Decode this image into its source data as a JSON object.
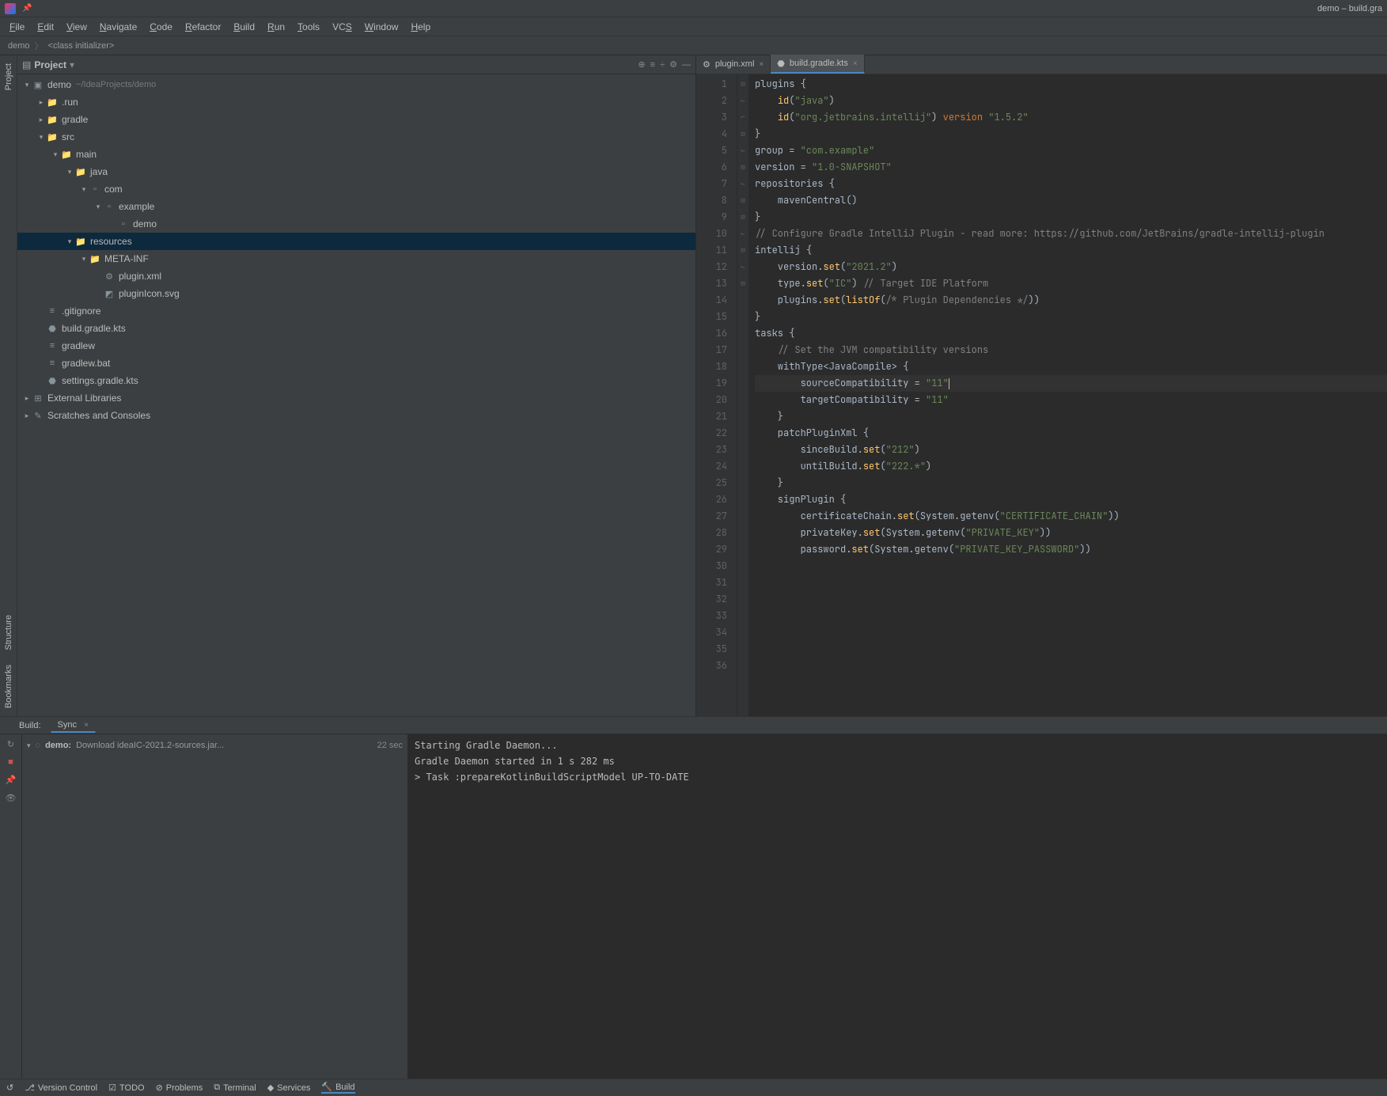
{
  "title_right": "demo – build.gra",
  "menu": [
    "File",
    "Edit",
    "View",
    "Navigate",
    "Code",
    "Refactor",
    "Build",
    "Run",
    "Tools",
    "VCS",
    "Window",
    "Help"
  ],
  "menu_underline_index": [
    0,
    0,
    0,
    0,
    0,
    0,
    0,
    0,
    0,
    2,
    0,
    0
  ],
  "breadcrumb": [
    "demo",
    "<class initializer>"
  ],
  "project_panel_title": "Project",
  "tree": [
    {
      "depth": 0,
      "arrow": "v",
      "icon": "module",
      "label": "demo",
      "hint": "~/IdeaProjects/demo"
    },
    {
      "depth": 1,
      "arrow": ">",
      "icon": "folder",
      "label": ".run"
    },
    {
      "depth": 1,
      "arrow": ">",
      "icon": "folder",
      "label": "gradle"
    },
    {
      "depth": 1,
      "arrow": "v",
      "icon": "folder",
      "label": "src"
    },
    {
      "depth": 2,
      "arrow": "v",
      "icon": "folder",
      "label": "main"
    },
    {
      "depth": 3,
      "arrow": "v",
      "icon": "sourceFolder",
      "label": "java"
    },
    {
      "depth": 4,
      "arrow": "v",
      "icon": "package",
      "label": "com"
    },
    {
      "depth": 5,
      "arrow": "v",
      "icon": "package",
      "label": "example"
    },
    {
      "depth": 6,
      "arrow": "",
      "icon": "package",
      "label": "demo"
    },
    {
      "depth": 3,
      "arrow": "v",
      "icon": "resourceFolder",
      "label": "resources",
      "hl": true
    },
    {
      "depth": 4,
      "arrow": "v",
      "icon": "folder",
      "label": "META-INF"
    },
    {
      "depth": 5,
      "arrow": "",
      "icon": "xml",
      "label": "plugin.xml"
    },
    {
      "depth": 5,
      "arrow": "",
      "icon": "svg",
      "label": "pluginIcon.svg"
    },
    {
      "depth": 1,
      "arrow": "",
      "icon": "file",
      "label": ".gitignore"
    },
    {
      "depth": 1,
      "arrow": "",
      "icon": "kts",
      "label": "build.gradle.kts"
    },
    {
      "depth": 1,
      "arrow": "",
      "icon": "sh",
      "label": "gradlew"
    },
    {
      "depth": 1,
      "arrow": "",
      "icon": "bat",
      "label": "gradlew.bat"
    },
    {
      "depth": 1,
      "arrow": "",
      "icon": "kts",
      "label": "settings.gradle.kts"
    },
    {
      "depth": 0,
      "arrow": ">",
      "icon": "lib",
      "label": "External Libraries"
    },
    {
      "depth": 0,
      "arrow": ">",
      "icon": "scratch",
      "label": "Scratches and Consoles"
    }
  ],
  "editor_tabs": [
    {
      "label": "plugin.xml",
      "icon": "xml",
      "active": false
    },
    {
      "label": "build.gradle.kts",
      "icon": "kts",
      "active": true
    }
  ],
  "code_lines": [
    [
      {
        "t": "plugins ",
        "c": ""
      },
      {
        "t": "{",
        "c": ""
      }
    ],
    [
      {
        "t": "    ",
        "c": ""
      },
      {
        "t": "id",
        "c": "fn"
      },
      {
        "t": "(",
        "c": ""
      },
      {
        "t": "\"java\"",
        "c": "str"
      },
      {
        "t": ")",
        "c": ""
      }
    ],
    [
      {
        "t": "    ",
        "c": ""
      },
      {
        "t": "id",
        "c": "fn"
      },
      {
        "t": "(",
        "c": ""
      },
      {
        "t": "\"org.jetbrains.intellij\"",
        "c": "str"
      },
      {
        "t": ") ",
        "c": ""
      },
      {
        "t": "version ",
        "c": "kw"
      },
      {
        "t": "\"1.5.2\"",
        "c": "str"
      }
    ],
    [
      {
        "t": "}",
        "c": ""
      }
    ],
    [
      {
        "t": "",
        "c": ""
      }
    ],
    [
      {
        "t": "group = ",
        "c": ""
      },
      {
        "t": "\"com.example\"",
        "c": "str"
      }
    ],
    [
      {
        "t": "version = ",
        "c": ""
      },
      {
        "t": "\"1.0-SNAPSHOT\"",
        "c": "str"
      }
    ],
    [
      {
        "t": "",
        "c": ""
      }
    ],
    [
      {
        "t": "repositories ",
        "c": ""
      },
      {
        "t": "{",
        "c": ""
      }
    ],
    [
      {
        "t": "    mavenCentral()",
        "c": ""
      }
    ],
    [
      {
        "t": "}",
        "c": ""
      }
    ],
    [
      {
        "t": "",
        "c": ""
      }
    ],
    [
      {
        "t": "// Configure Gradle IntelliJ Plugin - read more: https://github.com/JetBrains/gradle-intellij-plugin",
        "c": "cm"
      }
    ],
    [
      {
        "t": "intellij ",
        "c": ""
      },
      {
        "t": "{",
        "c": ""
      }
    ],
    [
      {
        "t": "    version.",
        "c": ""
      },
      {
        "t": "set",
        "c": "fn"
      },
      {
        "t": "(",
        "c": ""
      },
      {
        "t": "\"2021.2\"",
        "c": "str"
      },
      {
        "t": ")",
        "c": ""
      }
    ],
    [
      {
        "t": "    type.",
        "c": ""
      },
      {
        "t": "set",
        "c": "fn"
      },
      {
        "t": "(",
        "c": ""
      },
      {
        "t": "\"IC\"",
        "c": "str"
      },
      {
        "t": ") ",
        "c": ""
      },
      {
        "t": "// Target IDE Platform",
        "c": "cm"
      }
    ],
    [
      {
        "t": "",
        "c": ""
      }
    ],
    [
      {
        "t": "    plugins.",
        "c": ""
      },
      {
        "t": "set",
        "c": "fn"
      },
      {
        "t": "(",
        "c": ""
      },
      {
        "t": "listOf",
        "c": "fn"
      },
      {
        "t": "(",
        "c": ""
      },
      {
        "t": "/* Plugin Dependencies */",
        "c": "cm"
      },
      {
        "t": "))",
        "c": ""
      }
    ],
    [
      {
        "t": "}",
        "c": ""
      }
    ],
    [
      {
        "t": "",
        "c": ""
      }
    ],
    [
      {
        "t": "tasks ",
        "c": ""
      },
      {
        "t": "{",
        "c": ""
      }
    ],
    [
      {
        "t": "    ",
        "c": ""
      },
      {
        "t": "// Set the JVM compatibility versions",
        "c": "cm"
      }
    ],
    [
      {
        "t": "    withType<JavaCompile> {",
        "c": ""
      }
    ],
    [
      {
        "t": "        sourceCompatibility = ",
        "c": ""
      },
      {
        "t": "\"11\"",
        "c": "str"
      }
    ],
    [
      {
        "t": "        targetCompatibility = ",
        "c": ""
      },
      {
        "t": "\"11\"",
        "c": "str"
      }
    ],
    [
      {
        "t": "    }",
        "c": ""
      }
    ],
    [
      {
        "t": "",
        "c": ""
      }
    ],
    [
      {
        "t": "    patchPluginXml {",
        "c": ""
      }
    ],
    [
      {
        "t": "        sinceBuild.",
        "c": ""
      },
      {
        "t": "set",
        "c": "fn"
      },
      {
        "t": "(",
        "c": ""
      },
      {
        "t": "\"212\"",
        "c": "str"
      },
      {
        "t": ")",
        "c": ""
      }
    ],
    [
      {
        "t": "        untilBuild.",
        "c": ""
      },
      {
        "t": "set",
        "c": "fn"
      },
      {
        "t": "(",
        "c": ""
      },
      {
        "t": "\"222.*\"",
        "c": "str"
      },
      {
        "t": ")",
        "c": ""
      }
    ],
    [
      {
        "t": "    }",
        "c": ""
      }
    ],
    [
      {
        "t": "",
        "c": ""
      }
    ],
    [
      {
        "t": "    signPlugin {",
        "c": ""
      }
    ],
    [
      {
        "t": "        certificateChain.",
        "c": ""
      },
      {
        "t": "set",
        "c": "fn"
      },
      {
        "t": "(System.getenv(",
        "c": ""
      },
      {
        "t": "\"CERTIFICATE_CHAIN\"",
        "c": "str"
      },
      {
        "t": "))",
        "c": ""
      }
    ],
    [
      {
        "t": "        privateKey.",
        "c": ""
      },
      {
        "t": "set",
        "c": "fn"
      },
      {
        "t": "(System.getenv(",
        "c": ""
      },
      {
        "t": "\"PRIVATE_KEY\"",
        "c": "str"
      },
      {
        "t": "))",
        "c": ""
      }
    ],
    [
      {
        "t": "        password.",
        "c": ""
      },
      {
        "t": "set",
        "c": "fn"
      },
      {
        "t": "(System.getenv(",
        "c": ""
      },
      {
        "t": "\"PRIVATE_KEY_PASSWORD\"",
        "c": "str"
      },
      {
        "t": "))",
        "c": ""
      }
    ]
  ],
  "current_line": 24,
  "fold_marks": {
    "1": "-",
    "4": "]",
    "6": "[",
    "9": "-",
    "11": "]",
    "14": "-",
    "19": "]",
    "21": "-",
    "23": "-",
    "26": "]",
    "28": "-",
    "31": "]",
    "33": "-"
  },
  "build": {
    "label": "Build:",
    "tab": "Sync",
    "task": {
      "name": "demo:",
      "detail": "Download ideaIC-2021.2-sources.jar...",
      "time": "22 sec"
    },
    "output": [
      "Starting Gradle Daemon...",
      "Gradle Daemon started in 1 s 282 ms",
      "> Task :prepareKotlinBuildScriptModel UP-TO-DATE"
    ]
  },
  "statusbar": [
    {
      "icon": "↺",
      "label": ""
    },
    {
      "icon": "⎇",
      "label": "Version Control"
    },
    {
      "icon": "☑",
      "label": "TODO"
    },
    {
      "icon": "⊘",
      "label": "Problems"
    },
    {
      "icon": "⧉",
      "label": "Terminal"
    },
    {
      "icon": "◆",
      "label": "Services"
    },
    {
      "icon": "🔨",
      "label": "Build",
      "active": true
    }
  ],
  "left_gutter": {
    "top": [
      "Project"
    ],
    "bottom": [
      "Structure",
      "Bookmarks"
    ]
  }
}
